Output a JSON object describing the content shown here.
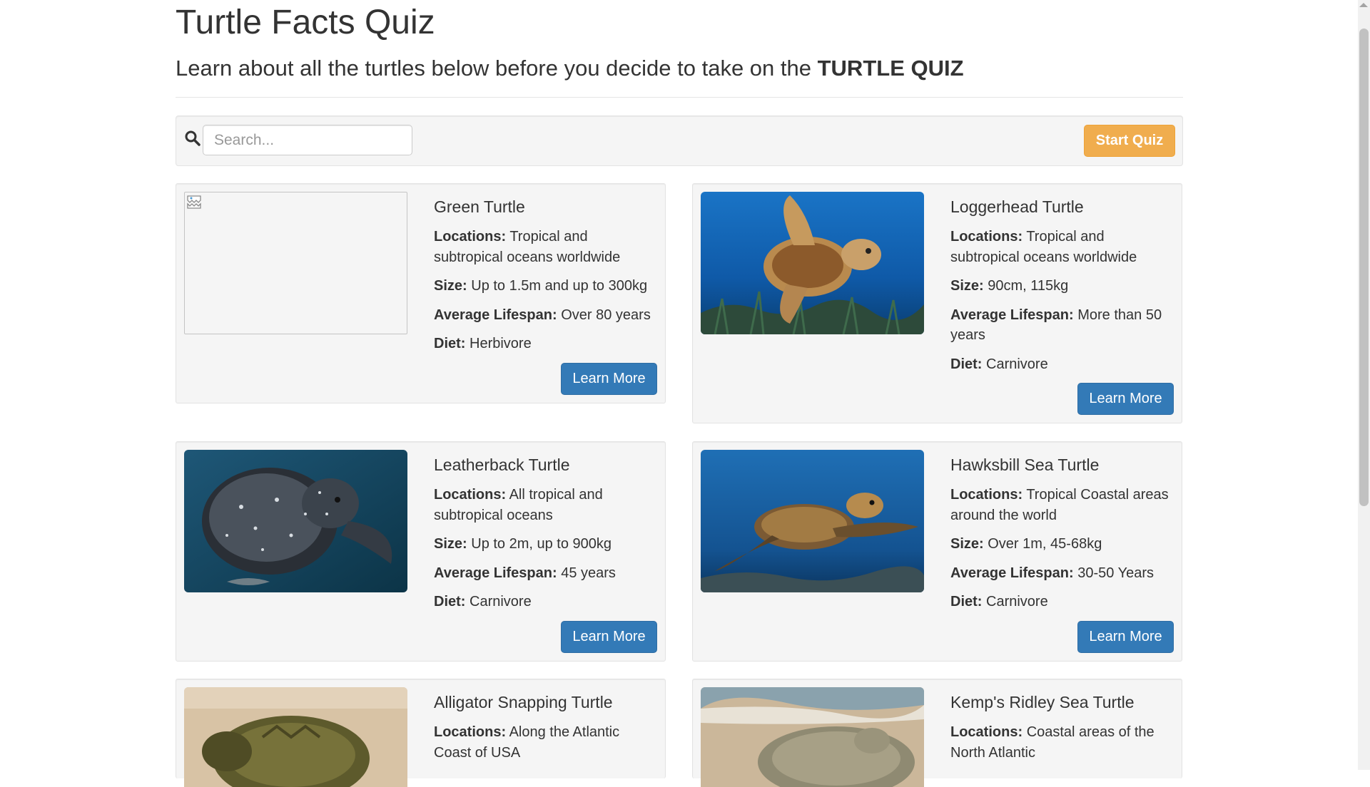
{
  "page": {
    "title": "Turtle Facts Quiz",
    "lead_text": "Learn about all the turtles below before you decide to take on the ",
    "lead_strong": "TURTLE QUIZ"
  },
  "toolbar": {
    "search_icon": "search-icon",
    "search_placeholder": "Search...",
    "search_value": "",
    "start_label": "Start Quiz",
    "start_color": "#f0ad4e"
  },
  "labels": {
    "locations": "Locations:",
    "size": "Size:",
    "lifespan": "Average Lifespan:",
    "diet": "Diet:",
    "learn_more": "Learn More"
  },
  "colors": {
    "primary": "#337ab7",
    "warning": "#f0ad4e",
    "panel": "#f5f5f5"
  },
  "turtles": [
    {
      "name": "Green Turtle",
      "locations": "Tropical and subtropical oceans worldwide",
      "size": "Up to 1.5m and up to 300kg",
      "lifespan": "Over 80 years",
      "diet": "Herbivore",
      "image": "broken-image-icon"
    },
    {
      "name": "Loggerhead Turtle",
      "locations": "Tropical and subtropical oceans worldwide",
      "size": "90cm, 115kg",
      "lifespan": "More than 50 years",
      "diet": "Carnivore",
      "image": "loggerhead-photo"
    },
    {
      "name": "Leatherback Turtle",
      "locations": "All tropical and subtropical oceans",
      "size": "Up to 2m, up to 900kg",
      "lifespan": "45 years",
      "diet": "Carnivore",
      "image": "leatherback-photo"
    },
    {
      "name": "Hawksbill Sea Turtle",
      "locations": "Tropical Coastal areas around the world",
      "size": "Over 1m, 45-68kg",
      "lifespan": "30-50 Years",
      "diet": "Carnivore",
      "image": "hawksbill-photo"
    },
    {
      "name": "Alligator Snapping Turtle",
      "locations": "Along the Atlantic Coast of USA",
      "image": "alligator-snapping-photo"
    },
    {
      "name": "Kemp's Ridley Sea Turtle",
      "locations": "Coastal areas of the North Atlantic",
      "image": "kemps-ridley-photo"
    }
  ]
}
